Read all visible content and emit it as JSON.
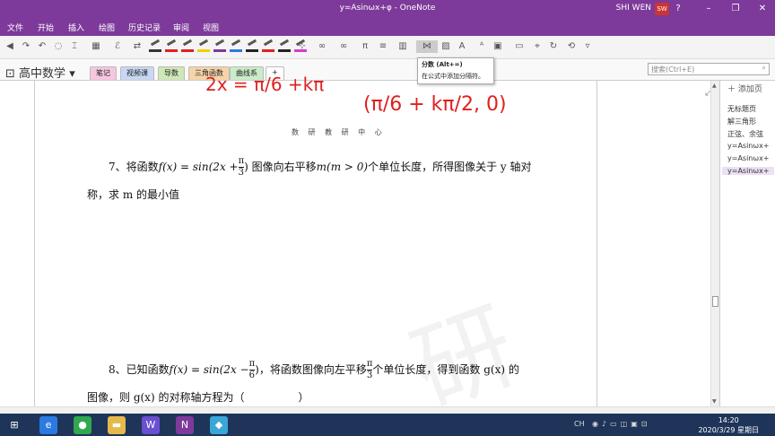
{
  "window": {
    "title": "y=Asinωx+φ  -  OneNote",
    "user_name": "SHI WEN",
    "user_initials": "SW",
    "controls": [
      "?",
      "–",
      "❐",
      "✕"
    ]
  },
  "menu": {
    "items": [
      "文件",
      "开始",
      "插入",
      "绘图",
      "历史记录",
      "审阅",
      "视图"
    ]
  },
  "ribbon": {
    "pen_colors": [
      "#333333",
      "#e02020",
      "#e02020",
      "#f0d000",
      "#7a3a9a",
      "#2a7ae2",
      "#222222",
      "#e02020",
      "#222222",
      "#d040d0"
    ]
  },
  "notebook": {
    "title": "高中数学",
    "sections": [
      {
        "label": "笔记",
        "color": "#f7c6e0"
      },
      {
        "label": "视频课",
        "color": "#c8d7f3"
      },
      {
        "label": "导数",
        "color": "#cfe8b7"
      },
      {
        "label": "三角函数",
        "color": "#f6d3a8"
      },
      {
        "label": "曲线系",
        "color": "#c9ecc9"
      }
    ],
    "add_section": "+",
    "search_placeholder": "搜索(Ctrl+E)"
  },
  "tooltip": {
    "title": "分数 (Alt+=)",
    "desc": "在公式中添加分隔符。"
  },
  "page": {
    "header": "数 研 教 研 中 心",
    "ink_top": "2x = π/6 +kπ",
    "ink_coord": "(π/6 + kπ/2, 0)",
    "q7": {
      "lead": "7、将函数",
      "f": "f(x) = sin(2x +",
      "num": "π",
      "den": "3",
      "mid": ") 图像向右平移",
      "m": "m(m > 0)",
      "tail": "个单位长度，所得图像关于 y 轴对",
      "line2": "称，求 m 的最小值"
    },
    "q8": {
      "lead": "8、已知函数",
      "f": "f(x) = sin(2x −",
      "num": "π",
      "den": "6",
      "mid": ")，将函数图像向左平移",
      "num2": "π",
      "den2": "3",
      "tail": "个单位长度，得到函数 g(x) 的",
      "line2": "图像，则 g(x) 的对称轴方程为（　　　　　）"
    },
    "watermark": "研"
  },
  "pages_panel": {
    "add_page": "添加页",
    "pages": [
      "无标题页",
      "解三角形",
      "正弦、余弦",
      "y=Asinωx+",
      "y=Asinωx+",
      "y=Asinωx+"
    ],
    "selected_index": 5
  },
  "taskbar": {
    "time": "14:20",
    "date": "2020/3/29 星期日",
    "tray_text": "CH",
    "apps": [
      {
        "name": "windows-start-icon",
        "glyph": "⊞",
        "color": "#1e3559"
      },
      {
        "name": "ie-icon",
        "glyph": "e",
        "color": "#2a7ae2"
      },
      {
        "name": "chrome-icon",
        "glyph": "●",
        "color": "#2fa84f"
      },
      {
        "name": "folder-icon",
        "glyph": "▬",
        "color": "#e6b94a"
      },
      {
        "name": "wps-icon",
        "glyph": "W",
        "color": "#6a4fd0"
      },
      {
        "name": "onenote-icon",
        "glyph": "N",
        "color": "#7d3a9a"
      },
      {
        "name": "app-icon",
        "glyph": "◆",
        "color": "#3aa7d8"
      }
    ]
  }
}
